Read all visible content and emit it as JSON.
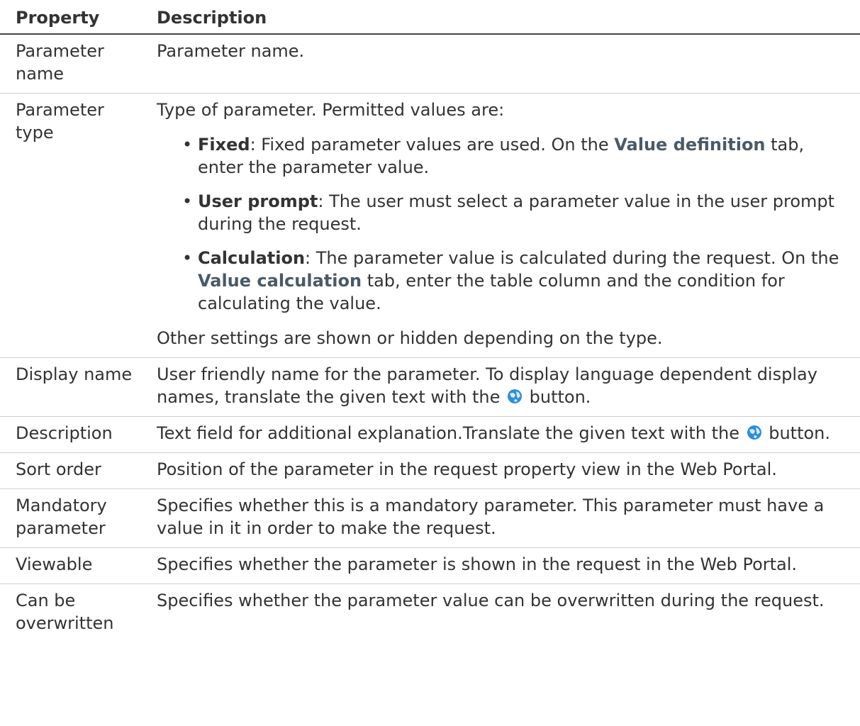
{
  "header": {
    "property": "Property",
    "description": "Description"
  },
  "rows": [
    {
      "property": "Parameter name",
      "description": "Parameter name."
    },
    {
      "property": "Parameter type",
      "intro": "Type of parameter. Permitted values are:",
      "bullets": [
        {
          "term": "Fixed",
          "text_a": ": Fixed parameter values are used. On the ",
          "ref": "Value definition",
          "text_b": " tab, enter the parameter value."
        },
        {
          "term": "User prompt",
          "text_a": ": The user must select a parameter value in the user prompt during the request."
        },
        {
          "term": "Calculation",
          "text_a": ": The parameter value is calculated during the request. On the ",
          "ref": "Value calculation",
          "text_b": " tab, enter the table column and the condition for calculating the value."
        }
      ],
      "outro": "Other settings are shown or hidden depending on the type."
    },
    {
      "property": "Display name",
      "text_a": "User friendly name for the parameter. To display language dependent display names, translate the given text with the ",
      "icon": "translate-globe-icon",
      "text_b": " button."
    },
    {
      "property": "Description",
      "text_a": "Text field for additional explanation.Translate the given text with the ",
      "icon": "translate-globe-icon",
      "text_b": " button."
    },
    {
      "property": "Sort order",
      "description": "Position of the parameter in the request property view in the Web Portal."
    },
    {
      "property": "Mandatory parameter",
      "description": "Specifies whether this is a mandatory parameter. This parameter must have a value in it in order to make the request."
    },
    {
      "property": "Viewable",
      "description": "Specifies whether the parameter is shown in the request in the Web Portal."
    },
    {
      "property": "Can be overwritten",
      "description": "Specifies whether the parameter value can be overwritten during the request."
    }
  ],
  "colors": {
    "text": "#333333",
    "reference": "#4a5a67",
    "icon": "#2f8fd6",
    "rule": "#cfcfcf"
  }
}
